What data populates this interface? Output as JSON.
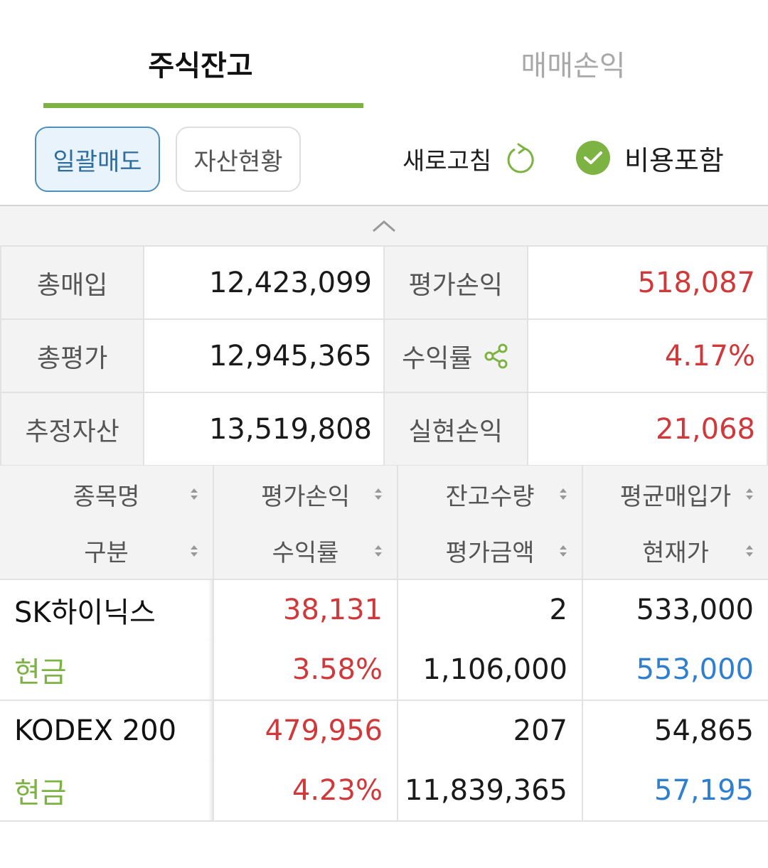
{
  "tabs": [
    {
      "label": "주식잔고",
      "active": true
    },
    {
      "label": "매매손익",
      "active": false
    }
  ],
  "toolbar": {
    "bulk_sell": "일괄매도",
    "asset_status": "자산현황",
    "refresh": "새로고침",
    "refresh_icon": "refresh-icon",
    "include_cost": "비용포함",
    "include_cost_checked": true
  },
  "colors": {
    "accent_green": "#7cb342",
    "profit_red": "#d0383a",
    "price_blue": "#2f7fd0"
  },
  "summary": {
    "total_purchase_label": "총매입",
    "total_purchase": "12,423,099",
    "eval_pl_label": "평가손익",
    "eval_pl": "518,087",
    "total_eval_label": "총평가",
    "total_eval": "12,945,365",
    "return_label": "수익률",
    "return": "4.17%",
    "est_asset_label": "추정자산",
    "est_asset": "13,519,808",
    "realized_pl_label": "실현손익",
    "realized_pl": "21,068"
  },
  "holdings": {
    "headers": {
      "name": "종목명",
      "eval_pl": "평가손익",
      "qty": "잔고수량",
      "avg_price": "평균매입가",
      "type": "구분",
      "return": "수익률",
      "eval_amount": "평가금액",
      "current_price": "현재가"
    },
    "rows": [
      {
        "name": "SK하이닉스",
        "type": "현금",
        "eval_pl": "38,131",
        "return": "3.58%",
        "qty": "2",
        "eval_amount": "1,106,000",
        "avg_price": "533,000",
        "current_price": "553,000"
      },
      {
        "name": "KODEX 200",
        "type": "현금",
        "eval_pl": "479,956",
        "return": "4.23%",
        "qty": "207",
        "eval_amount": "11,839,365",
        "avg_price": "54,865",
        "current_price": "57,195"
      }
    ]
  }
}
